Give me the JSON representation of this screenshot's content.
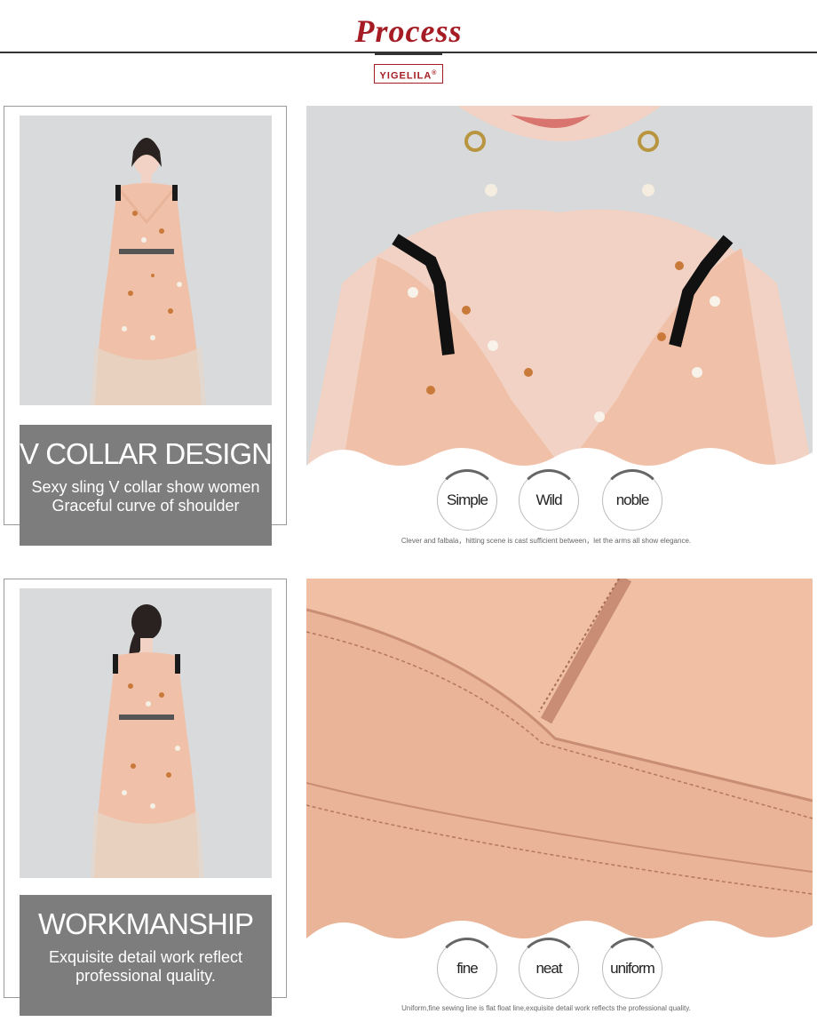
{
  "header": {
    "title": "Process",
    "brand": "YIGELILA",
    "brand_mark": "®"
  },
  "section1": {
    "heading": "V COLLAR DESIGN",
    "line1": "Sexy sling V collar show women",
    "line2": "Graceful curve of shoulder",
    "bubbles": [
      "Simple",
      "Wild",
      "noble"
    ],
    "caption": "Clever and falbala，hitting scene is cast sufficient between，let the arms all show elegance."
  },
  "section2": {
    "heading": "WORKMANSHIP",
    "line1": "Exquisite detail work reflect",
    "line2": "professional quality.",
    "bubbles": [
      "fine",
      "neat",
      "uniform"
    ],
    "caption": "Uniform,fine sewing line is flat float line,exquisite detail work reflects the professional quality."
  },
  "colors": {
    "accent": "#a51c24",
    "gray_box": "#7d7d7d",
    "dress": "#f0c1a8",
    "photo_bg": "#d9dadc"
  }
}
